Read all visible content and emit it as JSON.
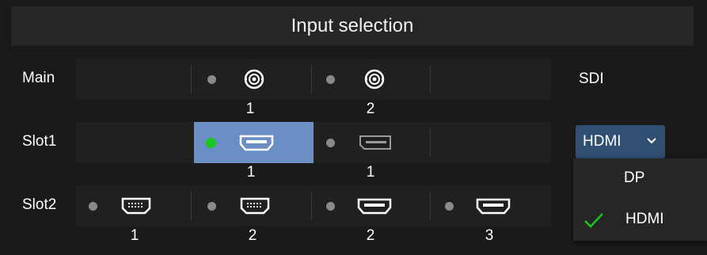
{
  "window": {
    "title": "Input selection"
  },
  "colors": {
    "accent_selected": "#6b8fc4",
    "active_indicator": "#19c61e",
    "inactive_indicator": "#8a8a8a",
    "dropdown_bg": "#2f4f73",
    "check_color": "#19c61e"
  },
  "rows": [
    {
      "label": "Main",
      "right_value": "SDI",
      "ports": [
        {
          "type": "sdi-bnc-icon",
          "number": "1",
          "active": false,
          "selected": false
        },
        {
          "type": "sdi-bnc-icon",
          "number": "2",
          "active": false,
          "selected": false
        }
      ]
    },
    {
      "label": "Slot1",
      "right_value": "HDMI",
      "ports": [
        {
          "type": "hdmi-icon",
          "number": "1",
          "active": true,
          "selected": true
        },
        {
          "type": "displayport-icon",
          "number": "1",
          "active": false,
          "selected": false,
          "dimmed": true
        }
      ]
    },
    {
      "label": "Slot2",
      "ports": [
        {
          "type": "dvi-icon",
          "number": "1",
          "active": false,
          "selected": false
        },
        {
          "type": "dvi-icon",
          "number": "2",
          "active": false,
          "selected": false
        },
        {
          "type": "hdmi-icon",
          "number": "2",
          "active": false,
          "selected": false
        },
        {
          "type": "hdmi-icon",
          "number": "3",
          "active": false,
          "selected": false
        }
      ]
    }
  ],
  "dropdown": {
    "selected": "HDMI",
    "options": [
      {
        "label": "DP",
        "checked": false
      },
      {
        "label": "HDMI",
        "checked": true
      }
    ]
  }
}
